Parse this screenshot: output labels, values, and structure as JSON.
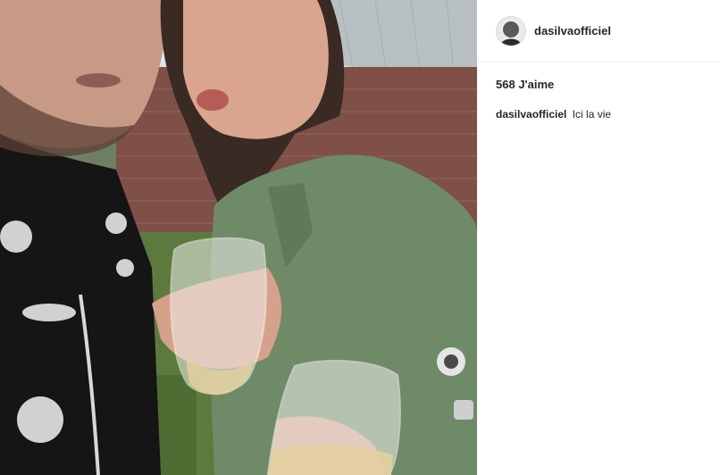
{
  "post": {
    "photo": {
      "description_icon": "photo-icon"
    },
    "header": {
      "username": "dasilvaofficiel",
      "avatar_icon": "avatar-icon"
    },
    "likes": {
      "count": "568",
      "label": "J'aime"
    },
    "caption": {
      "username": "dasilvaofficiel",
      "text": "Ici la vie"
    }
  }
}
